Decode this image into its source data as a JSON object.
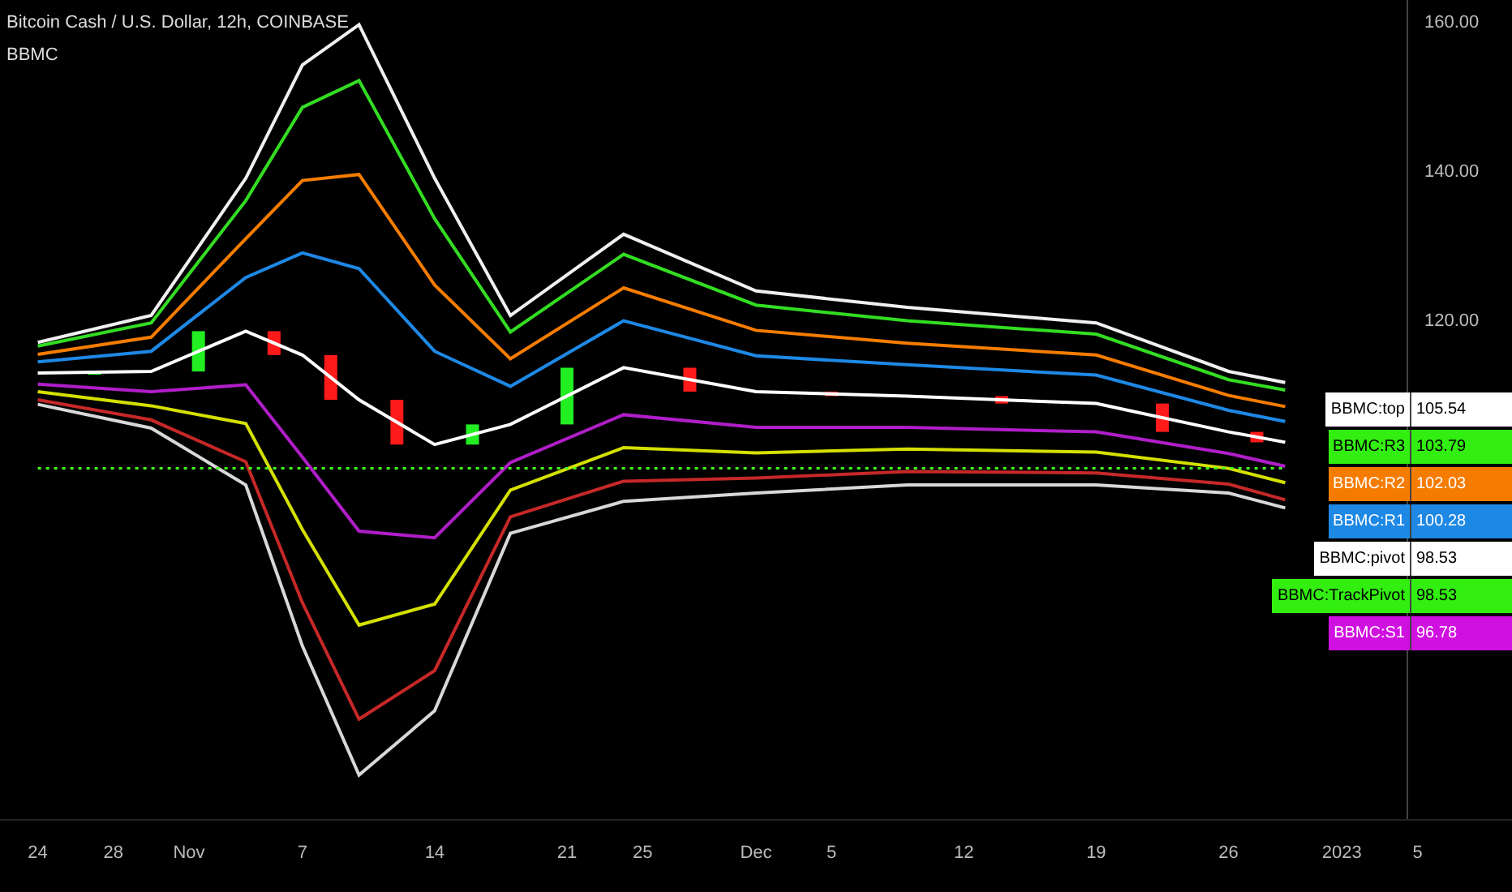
{
  "header": {
    "symbol": "Bitcoin Cash / U.S. Dollar, 12h, COINBASE",
    "indicator": "BBMC"
  },
  "chart": {
    "chart_data": {
      "type": "line",
      "xlim": [
        "2022-10-22",
        "2023-01-10"
      ],
      "ylim": [
        53.5,
        163.3
      ],
      "x": [
        "2022-10-24",
        "2022-10-30",
        "2022-11-04",
        "2022-11-07",
        "2022-11-10",
        "2022-11-14",
        "2022-11-18",
        "2022-11-24",
        "2022-12-01",
        "2022-12-09",
        "2022-12-19",
        "2022-12-26",
        "2022-12-29"
      ],
      "xticks": [
        {
          "value": "2022-10-24",
          "label": "24"
        },
        {
          "value": "2022-10-28",
          "label": "28"
        },
        {
          "value": "2022-11-01",
          "label": "Nov"
        },
        {
          "value": "2022-11-07",
          "label": "7"
        },
        {
          "value": "2022-11-14",
          "label": "14"
        },
        {
          "value": "2022-11-21",
          "label": "21"
        },
        {
          "value": "2022-11-25",
          "label": "25"
        },
        {
          "value": "2022-12-01",
          "label": "Dec"
        },
        {
          "value": "2022-12-05",
          "label": "5"
        },
        {
          "value": "2022-12-12",
          "label": "12"
        },
        {
          "value": "2022-12-19",
          "label": "19"
        },
        {
          "value": "2022-12-26",
          "label": "26"
        },
        {
          "value": "2023-01-01",
          "label": "2023"
        },
        {
          "value": "2023-01-05",
          "label": "5"
        }
      ],
      "yticks": [
        {
          "value": 120,
          "label": "120.00"
        },
        {
          "value": 140,
          "label": "140.00"
        },
        {
          "value": 160,
          "label": "160.00"
        }
      ],
      "series": [
        {
          "color": "#f0f0f0",
          "values": [
            117.4,
            121.0,
            139.4,
            154.6,
            160.0,
            139.4,
            121.0,
            131.9,
            124.3,
            122.1,
            120.0,
            113.5,
            112.0
          ]
        },
        {
          "color": "#33dd22",
          "values": [
            116.9,
            120.0,
            136.4,
            148.9,
            152.5,
            134.0,
            118.8,
            129.2,
            122.4,
            120.3,
            118.5,
            112.4,
            111.0
          ]
        },
        {
          "color": "#f57c00",
          "values": [
            115.8,
            118.1,
            131.3,
            139.1,
            139.9,
            125.1,
            115.2,
            124.7,
            119.0,
            117.3,
            115.7,
            110.3,
            108.8
          ]
        },
        {
          "color": "#1e88e5",
          "values": [
            114.8,
            116.2,
            126.1,
            129.4,
            127.3,
            116.2,
            111.5,
            120.3,
            115.6,
            114.4,
            113.0,
            108.3,
            106.8
          ]
        },
        {
          "color": "#ffffff",
          "values": [
            113.3,
            113.5,
            118.9,
            115.7,
            109.7,
            103.7,
            106.4,
            114.0,
            110.8,
            110.2,
            109.2,
            105.4,
            104.0
          ]
        },
        {
          "color": "#b01ec8",
          "values": [
            111.8,
            110.8,
            111.7,
            102.0,
            92.1,
            91.2,
            101.3,
            107.7,
            106.0,
            106.0,
            105.4,
            102.5,
            100.8
          ]
        },
        {
          "color": "#d4e000",
          "values": [
            110.8,
            108.9,
            106.5,
            92.3,
            79.5,
            82.3,
            97.6,
            103.3,
            102.6,
            103.1,
            102.7,
            100.5,
            98.6
          ]
        },
        {
          "color": "#c62828",
          "values": [
            109.7,
            107.0,
            101.4,
            82.5,
            66.9,
            73.4,
            94.0,
            98.8,
            99.2,
            100.1,
            99.9,
            98.4,
            96.3
          ]
        },
        {
          "color": "#d8d8d8",
          "values": [
            109.1,
            105.9,
            98.3,
            76.7,
            59.4,
            68.0,
            91.8,
            96.1,
            97.2,
            98.3,
            98.3,
            97.2,
            95.2
          ]
        },
        {
          "color": "#44ff22",
          "line_style": "dotted",
          "values": [
            100.5,
            100.5,
            100.5,
            100.5,
            100.5,
            100.5,
            100.5,
            100.5,
            100.5,
            100.5,
            100.5,
            100.5,
            100.5
          ]
        }
      ]
    }
  },
  "price_labels": [
    {
      "label": "BBMC:top",
      "value": "105.54",
      "color": "#ffffff"
    },
    {
      "label": "BBMC:R3",
      "value": "103.79",
      "color": "#33ee11"
    },
    {
      "label": "BBMC:R2",
      "value": "102.03",
      "color": "#f57c00"
    },
    {
      "label": "BBMC:R1",
      "value": "100.28",
      "color": "#1e88e5"
    },
    {
      "label": "BBMC:pivot",
      "value": "98.53",
      "color": "#ffffff"
    },
    {
      "label": "BBMC:TrackPivot",
      "value": "98.53",
      "color": "#33ee11"
    },
    {
      "label": "BBMC:S1",
      "value": "96.78",
      "color": "#d010e0"
    }
  ]
}
